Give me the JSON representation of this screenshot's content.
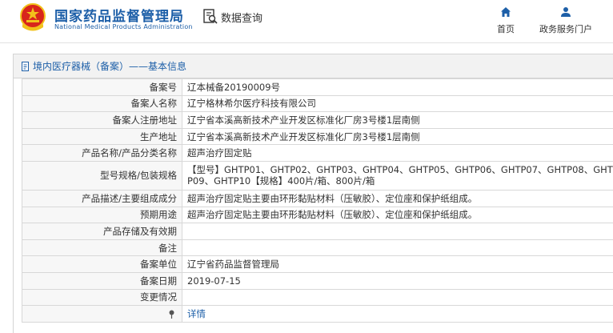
{
  "header": {
    "brand_cn": "国家药品监督管理局",
    "brand_en": "National Medical Products Administration",
    "search_label": "数据查询",
    "nav": [
      {
        "label": "首页",
        "icon": "home-icon"
      },
      {
        "label": "政务服务门户",
        "icon": "user-icon"
      }
    ]
  },
  "panel": {
    "title": "境内医疗器械（备案）——基本信息"
  },
  "rows": [
    {
      "label": "备案号",
      "value": "辽本械备20190009号"
    },
    {
      "label": "备案人名称",
      "value": "辽宁格林希尔医疗科技有限公司"
    },
    {
      "label": "备案人注册地址",
      "value": "辽宁省本溪高新技术产业开发区标准化厂房3号楼1层南侧"
    },
    {
      "label": "生产地址",
      "value": "辽宁省本溪高新技术产业开发区标准化厂房3号楼1层南侧"
    },
    {
      "label": "产品名称/产品分类名称",
      "value": "超声治疗固定贴"
    },
    {
      "label": "型号规格/包装规格",
      "value": "【型号】GHTP01、GHTP02、GHTP03、GHTP04、GHTP05、GHTP06、GHTP07、GHTP08、GHTP09、GHTP10【规格】400片/箱、800片/箱"
    },
    {
      "label": "产品描述/主要组成成分",
      "value": "超声治疗固定贴主要由环形黏贴材料（压敏胶）、定位座和保护纸组成。"
    },
    {
      "label": "预期用途",
      "value": "超声治疗固定贴主要由环形黏贴材料（压敏胶）、定位座和保护纸组成。"
    },
    {
      "label": "产品存储及有效期",
      "value": ""
    },
    {
      "label": "备注",
      "value": ""
    },
    {
      "label": "备案单位",
      "value": "辽宁省药品监督管理局"
    },
    {
      "label": "备案日期",
      "value": "2019-07-15"
    },
    {
      "label": "变更情况",
      "value": ""
    }
  ],
  "detail": {
    "link_label": "详情"
  },
  "colors": {
    "brand_blue": "#1d5fa8",
    "emblem_red": "#d8261c",
    "emblem_gold": "#f2c21b"
  }
}
